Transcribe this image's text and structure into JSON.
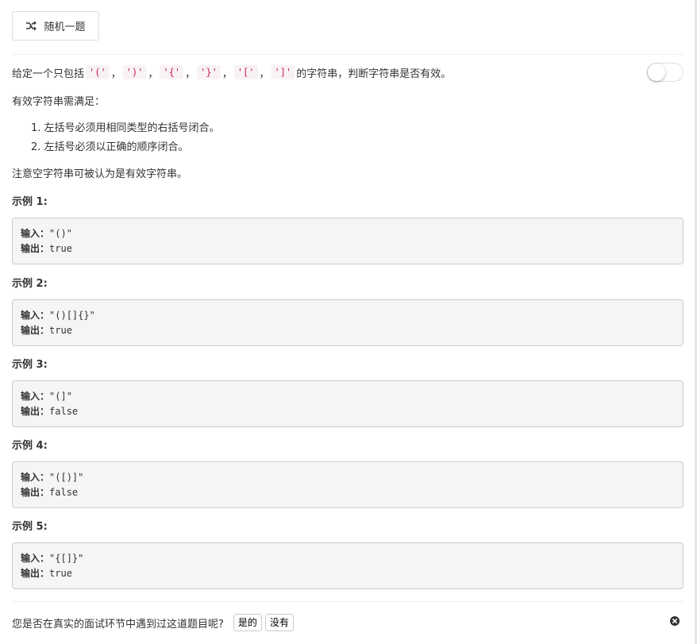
{
  "header": {
    "random_button_label": "随机一题"
  },
  "intro": {
    "prefix": "给定一个只包括 ",
    "tokens": [
      "'('",
      "')'",
      "'{'",
      "'}'",
      "'['",
      "']'"
    ],
    "separator": "，",
    "suffix": " 的字符串，判断字符串是否有效。"
  },
  "rules_title": "有效字符串需满足：",
  "rules": [
    "1. 左括号必须用相同类型的右括号闭合。",
    "2. 左括号必须以正确的顺序闭合。"
  ],
  "note": "注意空字符串可被认为是有效字符串。",
  "examples": [
    {
      "title": "示例 1:",
      "input_label": "输入",
      "input": "\"()\"",
      "output_label": "输出",
      "output": "true"
    },
    {
      "title": "示例 2:",
      "input_label": "输入",
      "input": "\"()[]{}\"",
      "output_label": "输出",
      "output": "true"
    },
    {
      "title": "示例 3:",
      "input_label": "输入",
      "input": "\"(]\"",
      "output_label": "输出",
      "output": "false"
    },
    {
      "title": "示例 4:",
      "input_label": "输入",
      "input": "\"([)]\"",
      "output_label": "输出",
      "output": "false"
    },
    {
      "title": "示例 5:",
      "input_label": "输入",
      "input": "\"{[]}\"",
      "output_label": "输出",
      "output": "true"
    }
  ],
  "footer": {
    "question": "您是否在真实的面试环节中遇到过这道题目呢?",
    "yes_label": "是的",
    "no_label": "没有"
  },
  "colors": {
    "code_text": "#c7254e",
    "code_bg": "#f9f2f4",
    "example_bg": "#f5f5f5"
  }
}
